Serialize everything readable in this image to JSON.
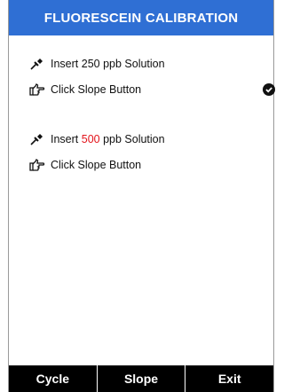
{
  "title": "FLUORESCEIN CALIBRATION",
  "step1": {
    "prefix": "Insert ",
    "value": "250",
    "suffix": " ppb Solution",
    "action": "Click Slope Button",
    "done_icon": "check-circle-icon"
  },
  "step2": {
    "prefix": "Insert ",
    "value": "500",
    "suffix": " ppb Solution",
    "action": "Click Slope Button"
  },
  "softkeys": {
    "cycle": "Cycle",
    "slope": "Slope",
    "exit": "Exit"
  },
  "colors": {
    "title_bg": "#2f6fd4",
    "highlight": "#e3141b",
    "softkey_bg": "#000000"
  }
}
